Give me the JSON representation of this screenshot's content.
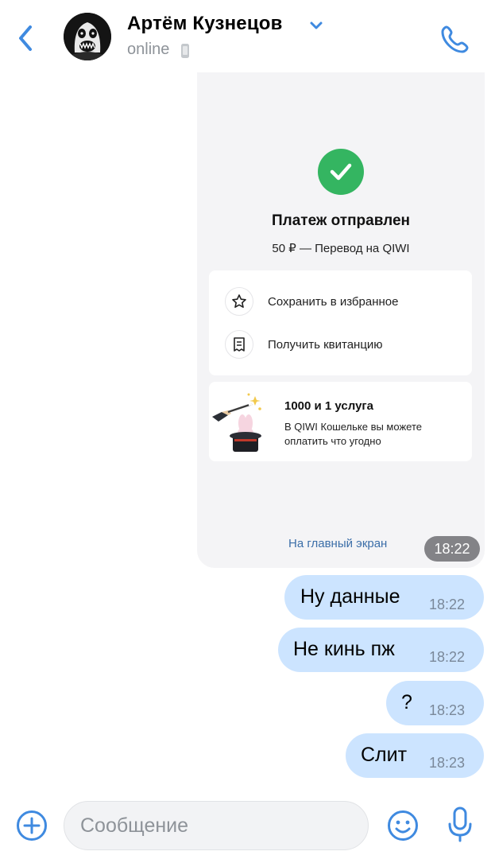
{
  "header": {
    "contact_name": "Артём Кузнецов",
    "status": "online",
    "icons": [
      "back-chevron-icon",
      "chevron-down-icon",
      "mobile-device-icon",
      "phone-call-icon"
    ]
  },
  "payment_card": {
    "title": "Платеж отправлен",
    "subtitle": "50 ₽ — Перевод на QIWI",
    "actions": [
      {
        "label": "Сохранить в избранное",
        "icon": "star-icon"
      },
      {
        "label": "Получить квитанцию",
        "icon": "receipt-icon"
      }
    ],
    "promo": {
      "title": "1000 и 1 услуга",
      "text": "В QIWI Кошельке вы можете оплатить что угодно"
    },
    "home_link": "На главный экран",
    "time": "18:22"
  },
  "messages": [
    {
      "text": "Ну данные",
      "time": "18:22"
    },
    {
      "text": "Не кинь пж",
      "time": "18:22"
    },
    {
      "text": "?",
      "time": "18:23"
    },
    {
      "text": "Слит",
      "time": "18:23"
    }
  ],
  "composer": {
    "placeholder": "Сообщение",
    "icons": [
      "plus-circle-icon",
      "emoji-icon",
      "microphone-icon"
    ]
  },
  "colors": {
    "accent": "#3f8ae0",
    "bubble": "#cce4ff",
    "success": "#34b561",
    "link": "#3b6ea8"
  }
}
